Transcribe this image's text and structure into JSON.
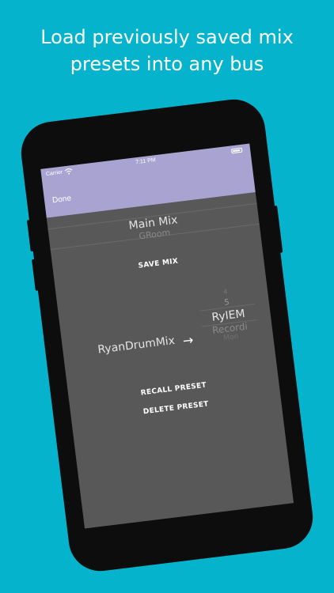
{
  "headline": {
    "line1": "Load previously saved mix",
    "line2": "presets into any bus"
  },
  "status_bar": {
    "carrier": "Carrier",
    "time": "7:11 PM",
    "icons": [
      "wifi-icon",
      "battery-icon"
    ]
  },
  "nav": {
    "done_label": "Done"
  },
  "mix_picker": {
    "selected": "Main Mix",
    "next": "GRoom"
  },
  "save_mix_label": "SAVE MIX",
  "preset": {
    "name": "RyanDrumMix",
    "arrow": "→"
  },
  "bus_picker": {
    "items": [
      "4",
      "5",
      "RyIEM",
      "Recordi",
      "Mon"
    ],
    "selected_index": 2
  },
  "recall_preset_label": "RECALL PRESET",
  "delete_preset_label": "DELETE PRESET",
  "colors": {
    "background": "#05b3cc",
    "nav_bar": "#a8a3d1",
    "screen": "#585858",
    "phone_body": "#0d0d0d"
  }
}
